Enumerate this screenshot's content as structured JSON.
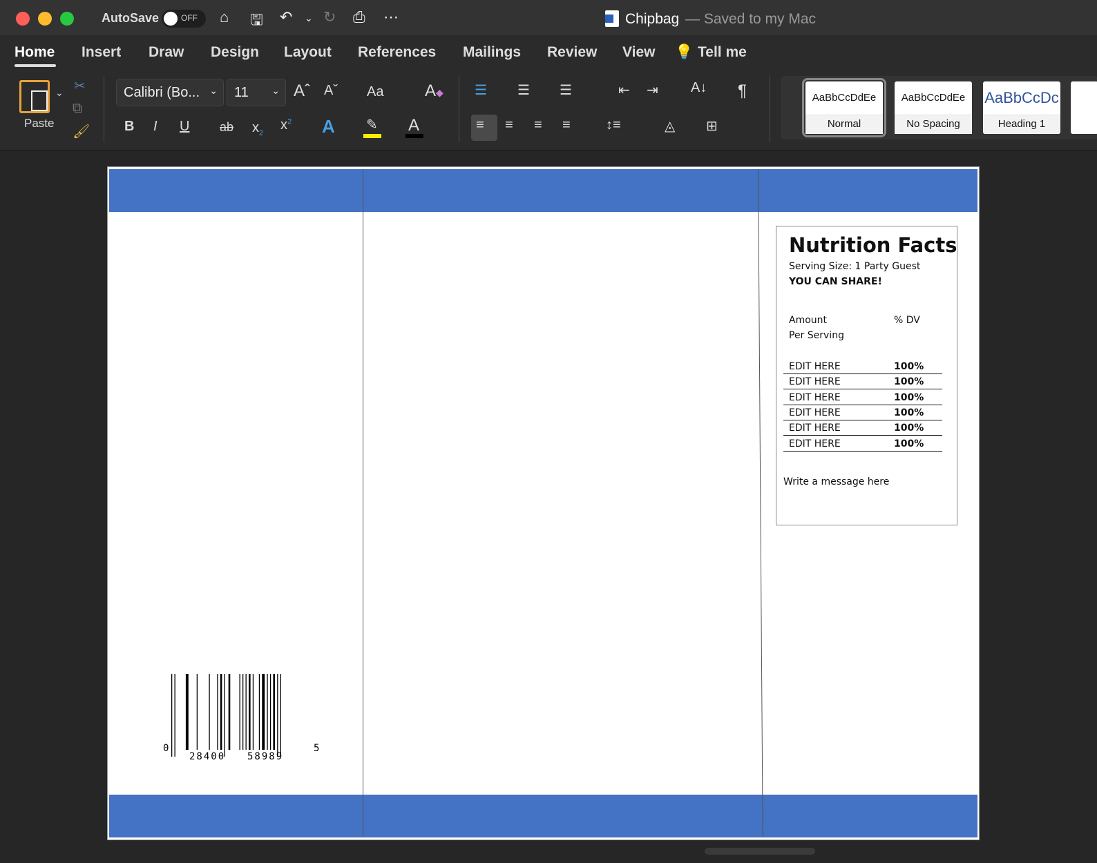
{
  "window": {
    "autosave_label": "AutoSave",
    "autosave_state": "OFF",
    "doc_name": "Chipbag",
    "save_status": "— Saved to my Mac"
  },
  "tabs": [
    "Home",
    "Insert",
    "Draw",
    "Design",
    "Layout",
    "References",
    "Mailings",
    "Review",
    "View",
    "Tell me"
  ],
  "ribbon": {
    "paste_label": "Paste",
    "font_name": "Calibri (Bo...",
    "font_size": "11",
    "change_case": "Aa",
    "styles": [
      {
        "preview": "AaBbCcDdEe",
        "name": "Normal"
      },
      {
        "preview": "AaBbCcDdEe",
        "name": "No Spacing"
      },
      {
        "preview": "AaBbCcDc",
        "name": "Heading 1"
      }
    ]
  },
  "nutrition": {
    "title": "Nutrition Facts",
    "serving": "Serving Size: 1 Party Guest",
    "share": "YOU CAN SHARE!",
    "amount": "Amount",
    "per_serving": "Per Serving",
    "dv": "% DV",
    "rows": [
      {
        "label": "EDIT HERE",
        "value": "100%"
      },
      {
        "label": "EDIT HERE",
        "value": "100%"
      },
      {
        "label": "EDIT HERE",
        "value": "100%"
      },
      {
        "label": "EDIT HERE",
        "value": "100%"
      },
      {
        "label": "EDIT HERE",
        "value": "100%"
      },
      {
        "label": "EDIT HERE",
        "value": "100%"
      }
    ],
    "message": "Write a message here"
  },
  "barcode": {
    "first": "0",
    "left": "28400",
    "right": "58989",
    "last": "5"
  },
  "colors": {
    "band": "#4472c4"
  }
}
